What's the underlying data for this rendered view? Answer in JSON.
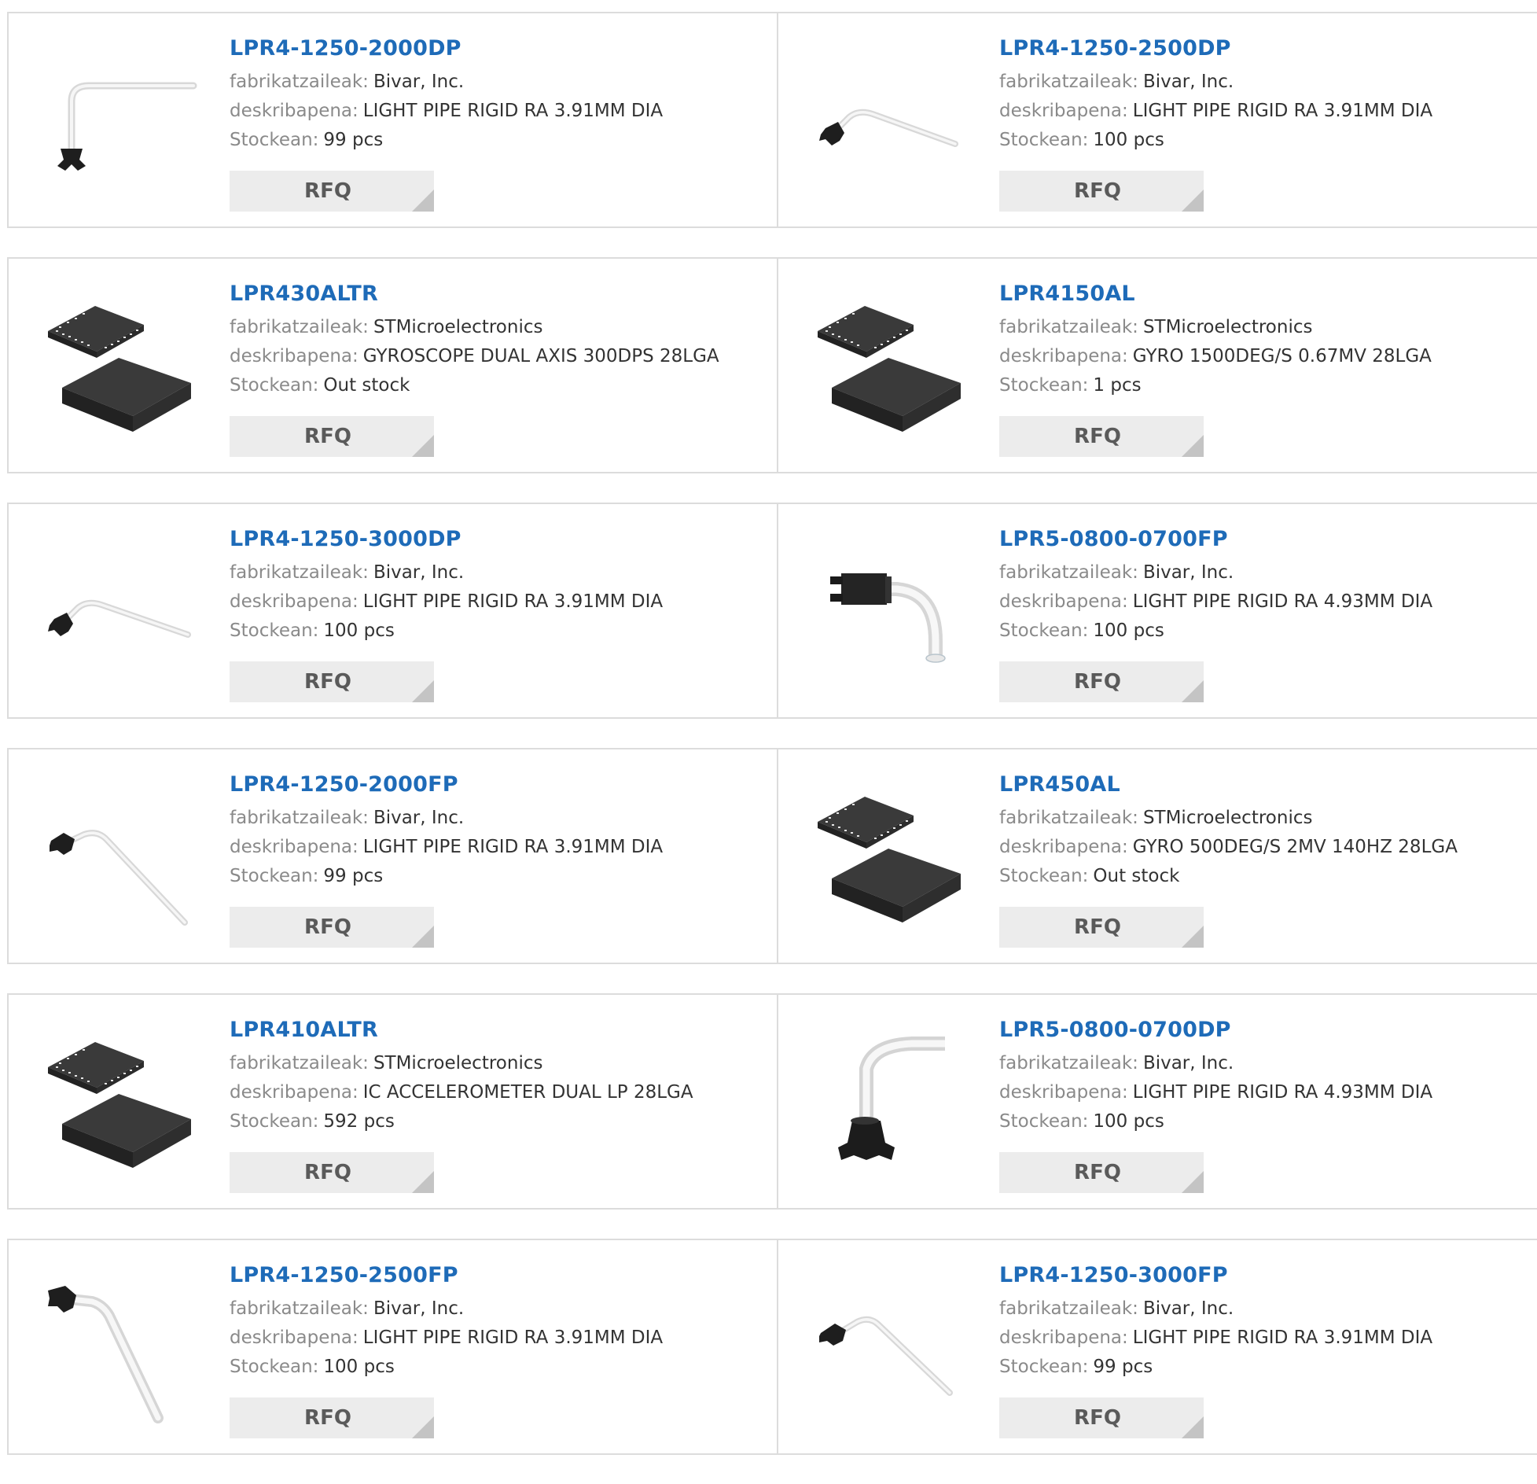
{
  "labels": {
    "manufacturer": "fabrikatzaileak:",
    "description": "deskribapena:",
    "stock": "Stockean:",
    "rfq": "RFQ"
  },
  "colors": {
    "link": "#1e6bb8",
    "label": "#8a8a8a",
    "value": "#333333",
    "button_bg": "#ececec"
  },
  "products": [
    {
      "name": "LPR4-1250-2000DP",
      "manufacturer": "Bivar, Inc.",
      "description": "LIGHT PIPE RIGID RA 3.91MM DIA",
      "stock": "99 pcs",
      "image": "light-pipe-image"
    },
    {
      "name": "LPR4-1250-2500DP",
      "manufacturer": "Bivar, Inc.",
      "description": "LIGHT PIPE RIGID RA 3.91MM DIA",
      "stock": "100 pcs",
      "image": "light-pipe-image"
    },
    {
      "name": "LPR430ALTR",
      "manufacturer": "STMicroelectronics",
      "description": "GYROSCOPE DUAL AXIS 300DPS 28LGA",
      "stock": "Out stock",
      "image": "lga-chip-image"
    },
    {
      "name": "LPR4150AL",
      "manufacturer": "STMicroelectronics",
      "description": "GYRO 1500DEG/S 0.67MV 28LGA",
      "stock": "1 pcs",
      "image": "lga-chip-image"
    },
    {
      "name": "LPR4-1250-3000DP",
      "manufacturer": "Bivar, Inc.",
      "description": "LIGHT PIPE RIGID RA 3.91MM DIA",
      "stock": "100 pcs",
      "image": "light-pipe-image"
    },
    {
      "name": "LPR5-0800-0700FP",
      "manufacturer": "Bivar, Inc.",
      "description": "LIGHT PIPE RIGID RA 4.93MM DIA",
      "stock": "100 pcs",
      "image": "light-pipe-image"
    },
    {
      "name": "LPR4-1250-2000FP",
      "manufacturer": "Bivar, Inc.",
      "description": "LIGHT PIPE RIGID RA 3.91MM DIA",
      "stock": "99 pcs",
      "image": "light-pipe-image"
    },
    {
      "name": "LPR450AL",
      "manufacturer": "STMicroelectronics",
      "description": "GYRO 500DEG/S 2MV 140HZ 28LGA",
      "stock": "Out stock",
      "image": "lga-chip-image"
    },
    {
      "name": "LPR410ALTR",
      "manufacturer": "STMicroelectronics",
      "description": "IC ACCELEROMETER DUAL LP 28LGA",
      "stock": "592 pcs",
      "image": "lga-chip-image"
    },
    {
      "name": "LPR5-0800-0700DP",
      "manufacturer": "Bivar, Inc.",
      "description": "LIGHT PIPE RIGID RA 4.93MM DIA",
      "stock": "100 pcs",
      "image": "light-pipe-image"
    },
    {
      "name": "LPR4-1250-2500FP",
      "manufacturer": "Bivar, Inc.",
      "description": "LIGHT PIPE RIGID RA 3.91MM DIA",
      "stock": "100 pcs",
      "image": "light-pipe-image"
    },
    {
      "name": "LPR4-1250-3000FP",
      "manufacturer": "Bivar, Inc.",
      "description": "LIGHT PIPE RIGID RA 3.91MM DIA",
      "stock": "99 pcs",
      "image": "light-pipe-image"
    }
  ]
}
